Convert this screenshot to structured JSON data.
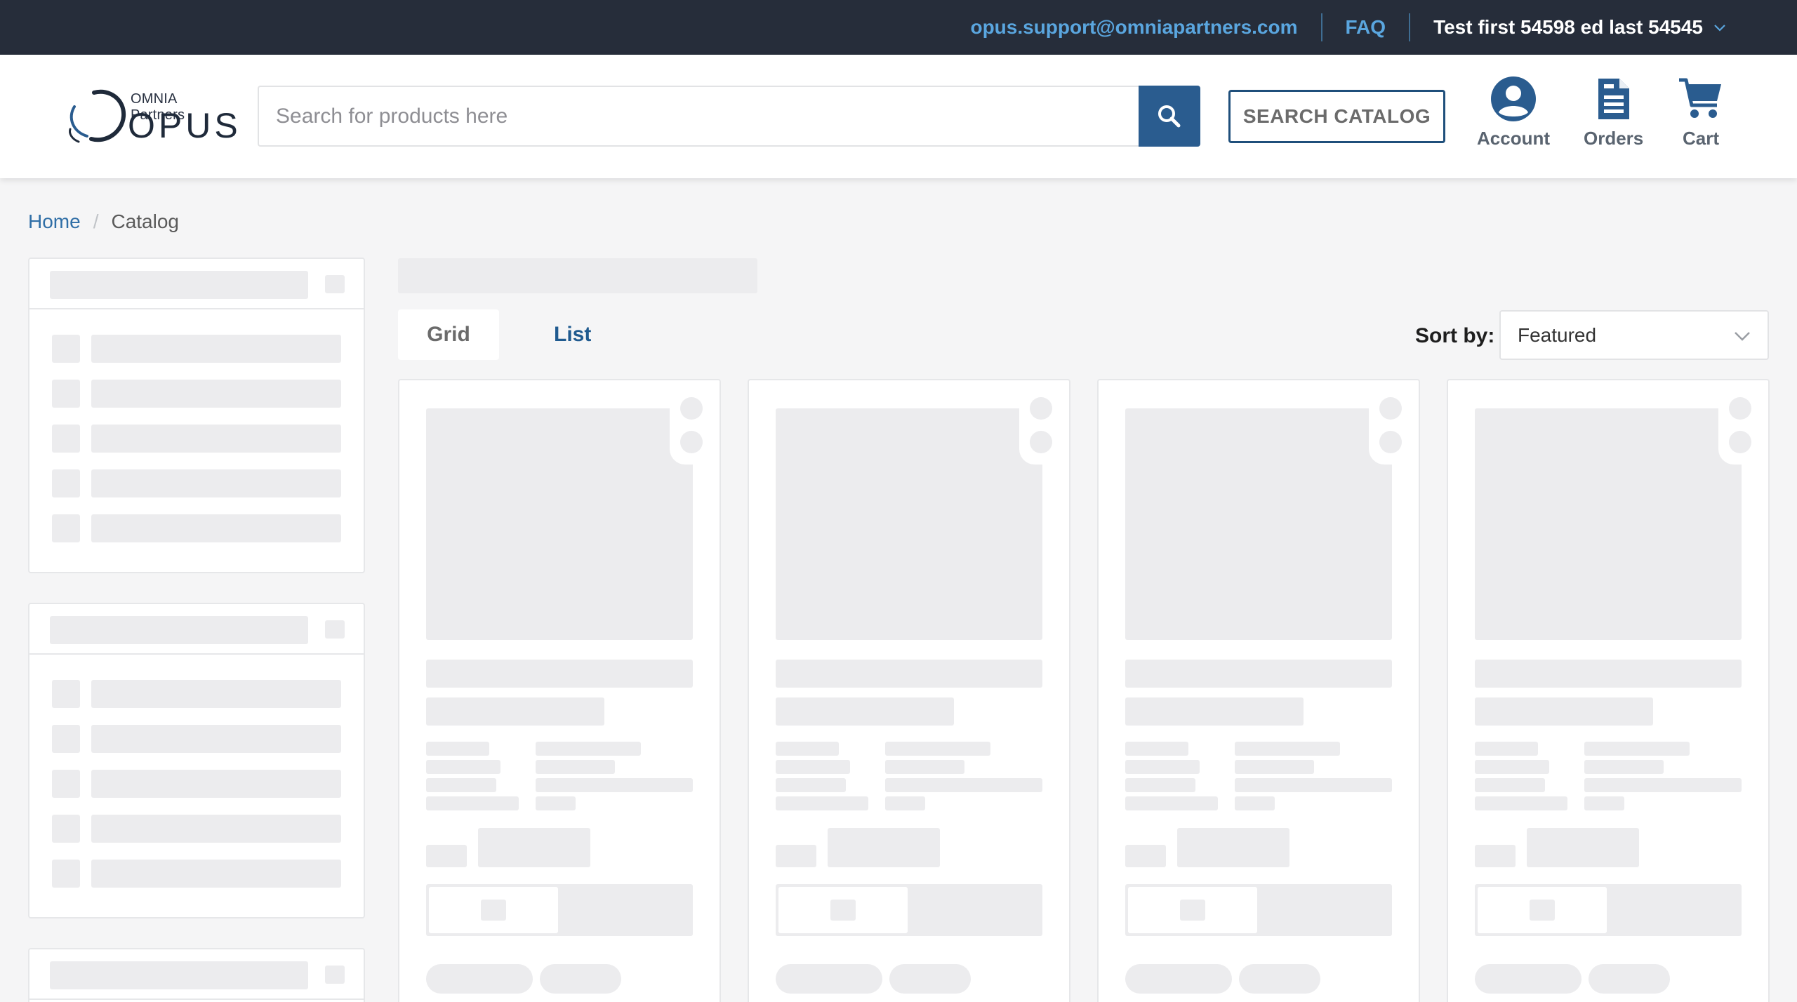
{
  "topbar": {
    "support_email": "opus.support@omniapartners.com",
    "faq": "FAQ",
    "user_name": "Test first 54598 ed last 54545"
  },
  "header": {
    "logo_partner": "OMNIA Partners",
    "logo_name": "OPUS",
    "search_placeholder": "Search for products here",
    "search_catalog": "SEARCH CATALOG",
    "account": "Account",
    "orders": "Orders",
    "cart": "Cart"
  },
  "breadcrumb": {
    "home": "Home",
    "separator": "/",
    "current": "Catalog"
  },
  "toolbar": {
    "grid": "Grid",
    "list": "List",
    "sort_label": "Sort by:",
    "sort_value": "Featured"
  },
  "colors": {
    "topbar_bg": "#262d3a",
    "link": "#5aa6df",
    "brand_blue": "#2a5c8f",
    "skeleton": "#ececee"
  },
  "icons": [
    "search-icon",
    "account-icon",
    "orders-icon",
    "cart-icon",
    "chevron-down-icon"
  ]
}
